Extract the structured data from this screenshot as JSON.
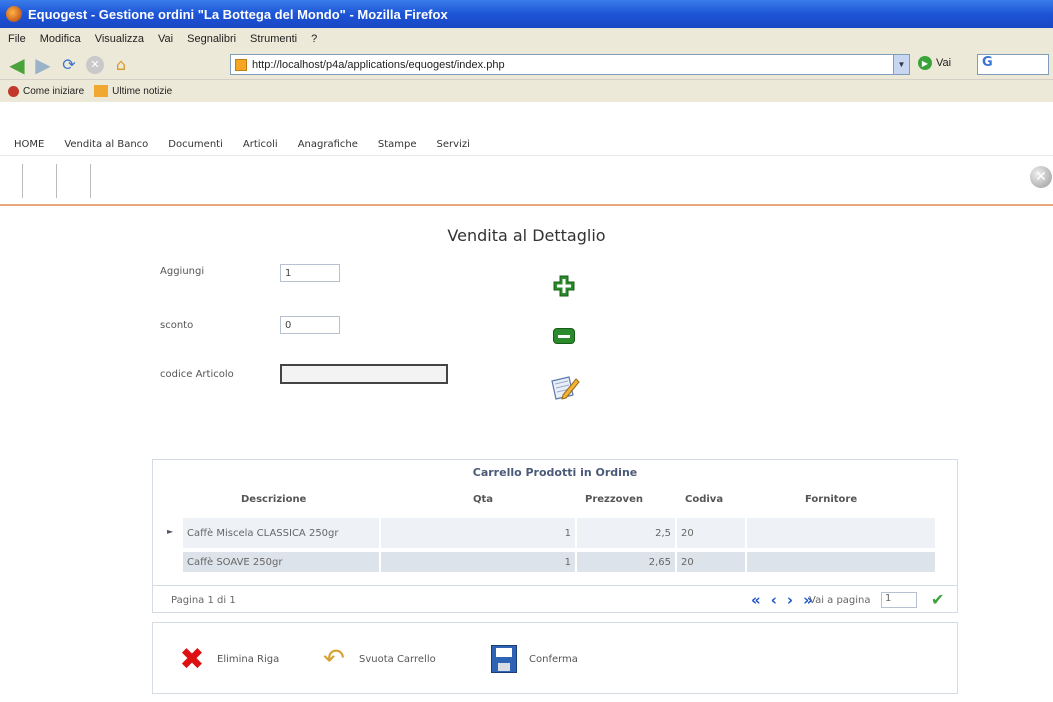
{
  "window": {
    "title": "Equogest - Gestione ordini \"La Bottega del Mondo\" - Mozilla Firefox"
  },
  "menubar": [
    "File",
    "Modifica",
    "Visualizza",
    "Vai",
    "Segnalibri",
    "Strumenti",
    "?"
  ],
  "nav": {
    "url": "http://localhost/p4a/applications/equogest/index.php",
    "go_label": "Vai"
  },
  "bookmarks": {
    "item1": "Come iniziare",
    "item2": "Ultime notizie"
  },
  "appmenu": [
    "HOME",
    "Vendita al Banco",
    "Documenti",
    "Articoli",
    "Anagrafiche",
    "Stampe",
    "Servizi"
  ],
  "page": {
    "title": "Vendita al Dettaglio"
  },
  "form": {
    "aggiungi_label": "Aggiungi",
    "aggiungi_value": "1",
    "sconto_label": "sconto",
    "sconto_value": "0",
    "codice_label": "codice Articolo",
    "codice_value": ""
  },
  "grid": {
    "title": "Carrello Prodotti in Ordine",
    "columns": [
      "Descrizione",
      "Qta",
      "Prezzoven",
      "Codiva",
      "Fornitore"
    ],
    "rows": [
      {
        "descrizione": "Caffè Miscela CLASSICA 250gr",
        "qta": "1",
        "prezzoven": "2,5",
        "codiva": "20",
        "fornitore": ""
      },
      {
        "descrizione": "Caffè SOAVE 250gr",
        "qta": "1",
        "prezzoven": "2,65",
        "codiva": "20",
        "fornitore": ""
      }
    ],
    "pager": {
      "info": "Pagina 1 di 1",
      "goto_label": "Vai a pagina",
      "goto_value": "1"
    }
  },
  "actions": {
    "delete_row": "Elimina Riga",
    "empty_cart": "Svuota Carrello",
    "confirm": "Conferma"
  },
  "colors": {
    "titlebar": "#1d55d6",
    "accent_line": "#e8a87c",
    "pager_nav": "#1e56c8"
  }
}
